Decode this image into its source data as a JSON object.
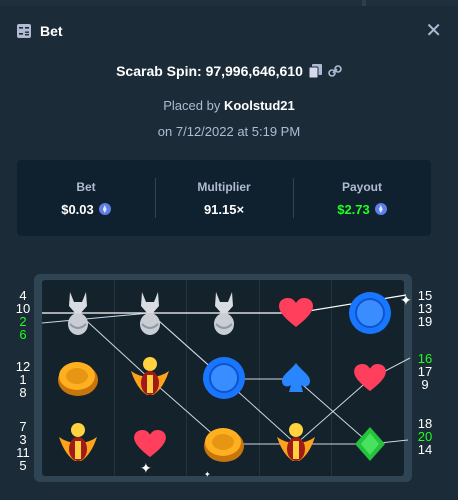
{
  "header": {
    "title": "Bet",
    "close_icon": "close-icon",
    "bet_icon": "bet-slip-icon"
  },
  "spin": {
    "label": "Scarab Spin: 97,996,646,610",
    "copy_icon": "copy-icon",
    "link_icon": "link-icon"
  },
  "placed": {
    "prefix": "Placed by ",
    "user": "Koolstud21"
  },
  "date": "on 7/12/2022 at 5:19 PM",
  "stats": {
    "bet_label": "Bet",
    "bet_value": "$0.03",
    "multiplier_label": "Multiplier",
    "multiplier_value": "91.15×",
    "payout_label": "Payout",
    "payout_value": "$2.73",
    "currency_icon": "ethereum-coin-icon",
    "payout_color": "#1fff20"
  },
  "paylines": {
    "left": [
      {
        "n": "4",
        "win": false
      },
      {
        "n": "10",
        "win": false
      },
      {
        "n": "2",
        "win": true
      },
      {
        "n": "6",
        "win": true
      },
      {
        "n": "12",
        "win": false
      },
      {
        "n": "1",
        "win": false
      },
      {
        "n": "8",
        "win": false
      },
      {
        "n": "7",
        "win": false
      },
      {
        "n": "3",
        "win": false
      },
      {
        "n": "11",
        "win": false
      },
      {
        "n": "5",
        "win": false
      }
    ],
    "right": [
      {
        "n": "15",
        "win": false
      },
      {
        "n": "13",
        "win": false
      },
      {
        "n": "19",
        "win": false
      },
      {
        "n": "16",
        "win": true
      },
      {
        "n": "17",
        "win": false
      },
      {
        "n": "9",
        "win": false
      },
      {
        "n": "18",
        "win": false
      },
      {
        "n": "20",
        "win": true
      },
      {
        "n": "14",
        "win": false
      }
    ]
  },
  "grid": [
    [
      "cat-statue",
      "cat-statue",
      "cat-statue",
      "heart",
      "blue-gem"
    ],
    [
      "gold-coin",
      "scarab",
      "blue-gem",
      "spade",
      "heart"
    ],
    [
      "scarab",
      "heart",
      "gold-coin",
      "scarab",
      "green-diamond"
    ]
  ],
  "colors": {
    "background": "#1b2c38",
    "panel": "#0f212e",
    "win_green": "#1fff20",
    "text_muted": "#b1bad3"
  }
}
